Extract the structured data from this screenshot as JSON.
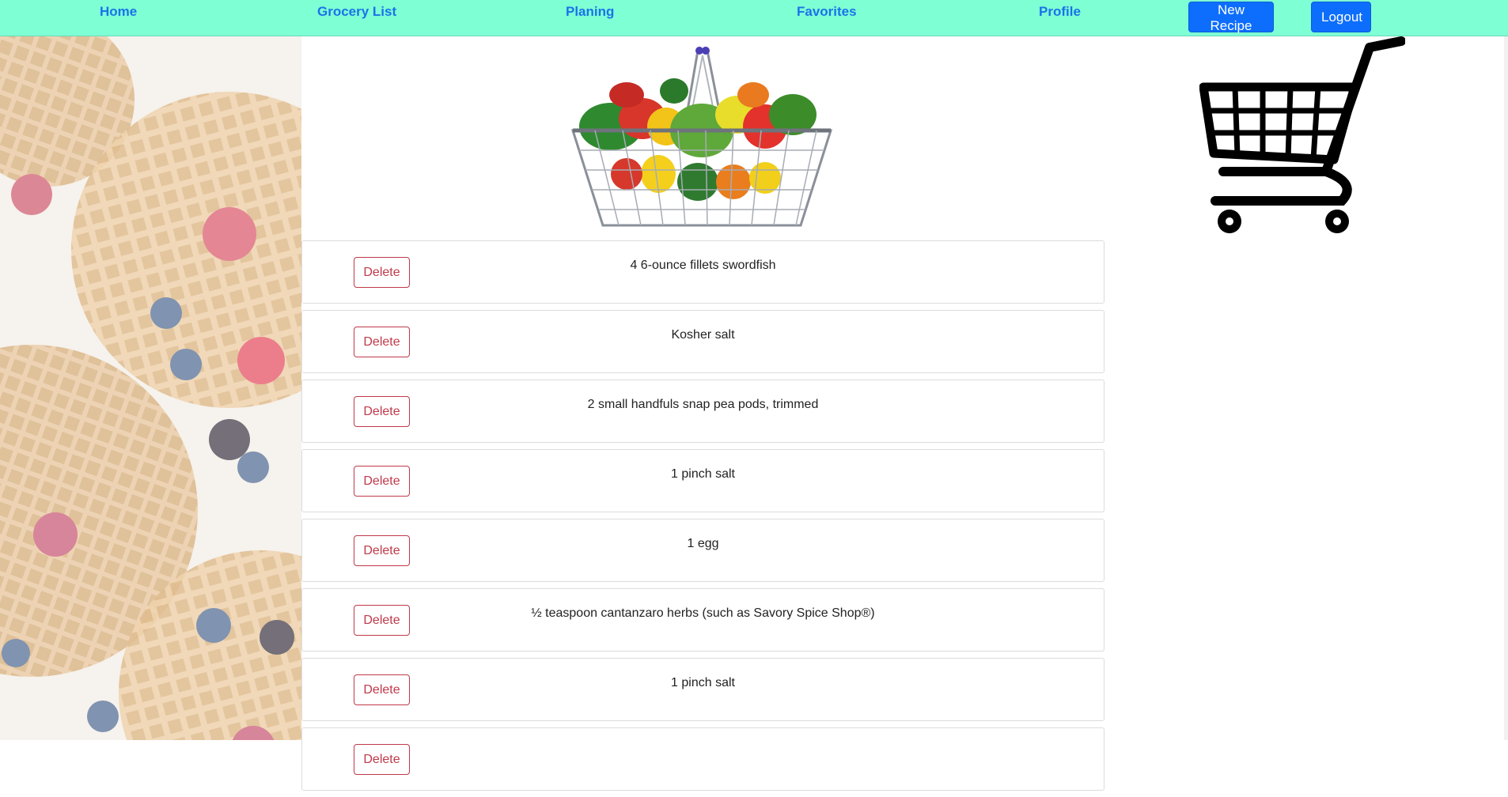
{
  "nav": {
    "links": [
      "Home",
      "Grocery List",
      "Planing",
      "Favorites",
      "Profile"
    ],
    "new_recipe_label": "New Recipe",
    "logout_label": "Logout"
  },
  "colors": {
    "nav_bg": "#7fffd4",
    "link": "#1a73e8",
    "primary_button": "#0d6efd",
    "delete_button": "#c0394a"
  },
  "icons": [
    "grocery-basket-image",
    "shopping-cart-icon",
    "waffle-background-image"
  ],
  "items": [
    {
      "delete_label": "Delete",
      "text": "4 6-ounce fillets swordfish"
    },
    {
      "delete_label": "Delete",
      "text": "Kosher salt"
    },
    {
      "delete_label": "Delete",
      "text": "2 small handfuls snap pea pods, trimmed"
    },
    {
      "delete_label": "Delete",
      "text": "1 pinch salt"
    },
    {
      "delete_label": "Delete",
      "text": "1 egg"
    },
    {
      "delete_label": "Delete",
      "text": "½ teaspoon cantanzaro herbs (such as Savory Spice Shop®)"
    },
    {
      "delete_label": "Delete",
      "text": "1 pinch salt"
    },
    {
      "delete_label": "Delete",
      "text": ""
    }
  ]
}
